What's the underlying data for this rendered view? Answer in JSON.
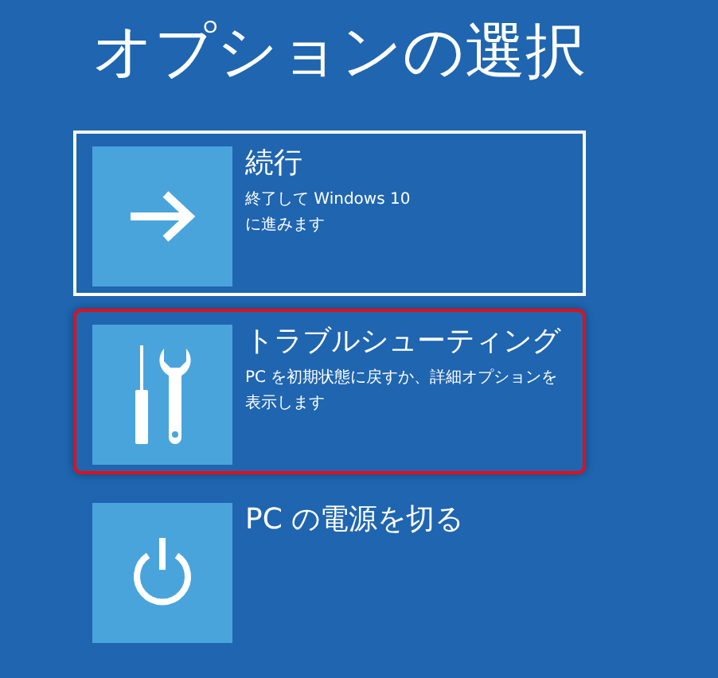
{
  "title": "オプションの選択",
  "options": [
    {
      "kind": "arrow",
      "label": "続行",
      "description": [
        "終了して Windows 10",
        "に進みます"
      ],
      "focused": true,
      "highlighted": false
    },
    {
      "kind": "tools",
      "label": "トラブルシューティング",
      "description": [
        "PC を初期状態に戻すか、詳細オプションを",
        "表示します"
      ],
      "focused": false,
      "highlighted": true
    },
    {
      "kind": "power",
      "label": "PC の電源を切る",
      "focused": false,
      "highlighted": false
    }
  ]
}
